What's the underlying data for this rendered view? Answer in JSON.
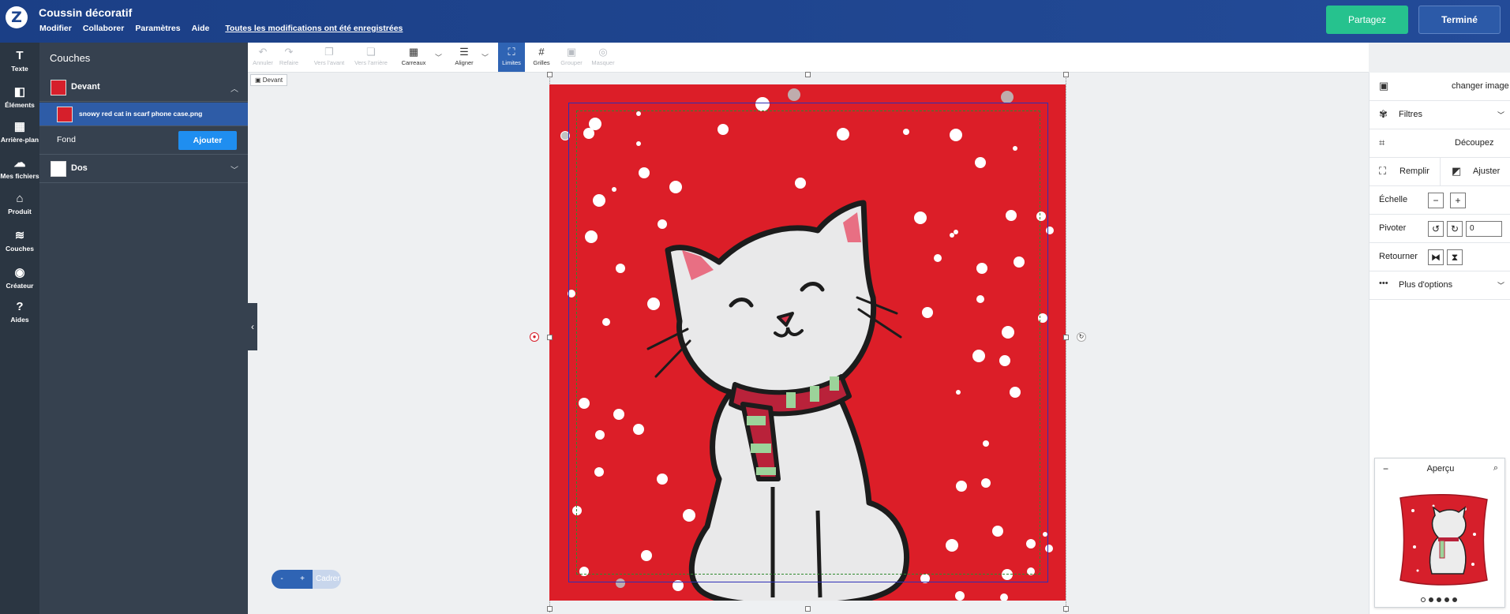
{
  "header": {
    "logo": "Z",
    "doc_title": "Coussin décoratif",
    "menu": [
      "Modifier",
      "Collaborer",
      "Paramètres",
      "Aide"
    ],
    "saved_status": "Toutes les modifications ont été enregistrées",
    "share_label": "Partagez",
    "done_label": "Terminé"
  },
  "rail": [
    {
      "label": "Texte",
      "icon": "text-icon",
      "glyph": "T"
    },
    {
      "label": "Éléments",
      "icon": "elements-icon",
      "glyph": "◧"
    },
    {
      "label": "Arrière-plan",
      "icon": "background-icon",
      "glyph": "▦"
    },
    {
      "label": "Mes fichiers",
      "icon": "cloud-upload-icon",
      "glyph": "☁"
    },
    {
      "label": "Produit",
      "icon": "product-icon",
      "glyph": "⌂"
    },
    {
      "label": "Couches",
      "icon": "layers-icon",
      "glyph": "≋"
    },
    {
      "label": "Créateur",
      "icon": "user-icon",
      "glyph": "◉"
    },
    {
      "label": "Aides",
      "icon": "help-icon",
      "glyph": "?"
    }
  ],
  "layers": {
    "title": "Couches",
    "front_label": "Devant",
    "image_layer": "snowy red cat in scarf phone case.png",
    "background_label": "Fond",
    "add_label": "Ajouter",
    "back_label": "Dos"
  },
  "toolbar": {
    "tools": [
      {
        "label": "Annuler",
        "glyph": "↶"
      },
      {
        "label": "Refaire",
        "glyph": "↷"
      },
      {
        "label": "Vers l'avant",
        "glyph": "❐"
      },
      {
        "label": "Vers l'arrière",
        "glyph": "❏"
      },
      {
        "label": "Carreaux",
        "glyph": "▦"
      },
      {
        "label": "Aligner",
        "glyph": "☰"
      },
      {
        "label": "Limites",
        "glyph": "⛶"
      },
      {
        "label": "Grilles",
        "glyph": "#"
      },
      {
        "label": "Grouper",
        "glyph": "▣"
      },
      {
        "label": "Masquer",
        "glyph": "◎"
      }
    ],
    "face_tag": "Devant"
  },
  "zoom": {
    "minus": "-",
    "plus": "+",
    "fit": "Cadrer"
  },
  "right_panel": {
    "change_image": "changer image",
    "filters": "Filtres",
    "crop": "Découpez",
    "fill": "Remplir",
    "adjust": "Ajuster",
    "scale": "Échelle",
    "rotate": "Pivoter",
    "rotate_value": "0",
    "flip": "Retourner",
    "more_options": "Plus d'options"
  },
  "preview": {
    "title": "Aperçu",
    "minimize": "−",
    "pages": 5,
    "current_page": 1
  },
  "colors": {
    "header": "#1e4690",
    "accent_green": "#26c28e",
    "cushion_red": "#d61f2b",
    "panel_dark": "#36414f"
  }
}
